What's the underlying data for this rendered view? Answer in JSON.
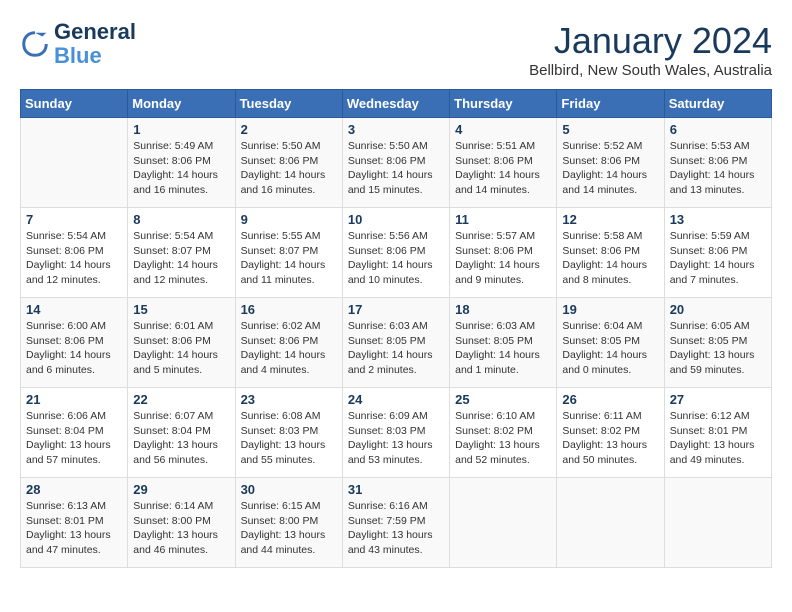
{
  "header": {
    "logo_line1": "General",
    "logo_line2": "Blue",
    "month_year": "January 2024",
    "location": "Bellbird, New South Wales, Australia"
  },
  "days_of_week": [
    "Sunday",
    "Monday",
    "Tuesday",
    "Wednesday",
    "Thursday",
    "Friday",
    "Saturday"
  ],
  "weeks": [
    [
      {
        "day": "",
        "info": ""
      },
      {
        "day": "1",
        "info": "Sunrise: 5:49 AM\nSunset: 8:06 PM\nDaylight: 14 hours\nand 16 minutes."
      },
      {
        "day": "2",
        "info": "Sunrise: 5:50 AM\nSunset: 8:06 PM\nDaylight: 14 hours\nand 16 minutes."
      },
      {
        "day": "3",
        "info": "Sunrise: 5:50 AM\nSunset: 8:06 PM\nDaylight: 14 hours\nand 15 minutes."
      },
      {
        "day": "4",
        "info": "Sunrise: 5:51 AM\nSunset: 8:06 PM\nDaylight: 14 hours\nand 14 minutes."
      },
      {
        "day": "5",
        "info": "Sunrise: 5:52 AM\nSunset: 8:06 PM\nDaylight: 14 hours\nand 14 minutes."
      },
      {
        "day": "6",
        "info": "Sunrise: 5:53 AM\nSunset: 8:06 PM\nDaylight: 14 hours\nand 13 minutes."
      }
    ],
    [
      {
        "day": "7",
        "info": "Sunrise: 5:54 AM\nSunset: 8:06 PM\nDaylight: 14 hours\nand 12 minutes."
      },
      {
        "day": "8",
        "info": "Sunrise: 5:54 AM\nSunset: 8:07 PM\nDaylight: 14 hours\nand 12 minutes."
      },
      {
        "day": "9",
        "info": "Sunrise: 5:55 AM\nSunset: 8:07 PM\nDaylight: 14 hours\nand 11 minutes."
      },
      {
        "day": "10",
        "info": "Sunrise: 5:56 AM\nSunset: 8:06 PM\nDaylight: 14 hours\nand 10 minutes."
      },
      {
        "day": "11",
        "info": "Sunrise: 5:57 AM\nSunset: 8:06 PM\nDaylight: 14 hours\nand 9 minutes."
      },
      {
        "day": "12",
        "info": "Sunrise: 5:58 AM\nSunset: 8:06 PM\nDaylight: 14 hours\nand 8 minutes."
      },
      {
        "day": "13",
        "info": "Sunrise: 5:59 AM\nSunset: 8:06 PM\nDaylight: 14 hours\nand 7 minutes."
      }
    ],
    [
      {
        "day": "14",
        "info": "Sunrise: 6:00 AM\nSunset: 8:06 PM\nDaylight: 14 hours\nand 6 minutes."
      },
      {
        "day": "15",
        "info": "Sunrise: 6:01 AM\nSunset: 8:06 PM\nDaylight: 14 hours\nand 5 minutes."
      },
      {
        "day": "16",
        "info": "Sunrise: 6:02 AM\nSunset: 8:06 PM\nDaylight: 14 hours\nand 4 minutes."
      },
      {
        "day": "17",
        "info": "Sunrise: 6:03 AM\nSunset: 8:05 PM\nDaylight: 14 hours\nand 2 minutes."
      },
      {
        "day": "18",
        "info": "Sunrise: 6:03 AM\nSunset: 8:05 PM\nDaylight: 14 hours\nand 1 minute."
      },
      {
        "day": "19",
        "info": "Sunrise: 6:04 AM\nSunset: 8:05 PM\nDaylight: 14 hours\nand 0 minutes."
      },
      {
        "day": "20",
        "info": "Sunrise: 6:05 AM\nSunset: 8:05 PM\nDaylight: 13 hours\nand 59 minutes."
      }
    ],
    [
      {
        "day": "21",
        "info": "Sunrise: 6:06 AM\nSunset: 8:04 PM\nDaylight: 13 hours\nand 57 minutes."
      },
      {
        "day": "22",
        "info": "Sunrise: 6:07 AM\nSunset: 8:04 PM\nDaylight: 13 hours\nand 56 minutes."
      },
      {
        "day": "23",
        "info": "Sunrise: 6:08 AM\nSunset: 8:03 PM\nDaylight: 13 hours\nand 55 minutes."
      },
      {
        "day": "24",
        "info": "Sunrise: 6:09 AM\nSunset: 8:03 PM\nDaylight: 13 hours\nand 53 minutes."
      },
      {
        "day": "25",
        "info": "Sunrise: 6:10 AM\nSunset: 8:02 PM\nDaylight: 13 hours\nand 52 minutes."
      },
      {
        "day": "26",
        "info": "Sunrise: 6:11 AM\nSunset: 8:02 PM\nDaylight: 13 hours\nand 50 minutes."
      },
      {
        "day": "27",
        "info": "Sunrise: 6:12 AM\nSunset: 8:01 PM\nDaylight: 13 hours\nand 49 minutes."
      }
    ],
    [
      {
        "day": "28",
        "info": "Sunrise: 6:13 AM\nSunset: 8:01 PM\nDaylight: 13 hours\nand 47 minutes."
      },
      {
        "day": "29",
        "info": "Sunrise: 6:14 AM\nSunset: 8:00 PM\nDaylight: 13 hours\nand 46 minutes."
      },
      {
        "day": "30",
        "info": "Sunrise: 6:15 AM\nSunset: 8:00 PM\nDaylight: 13 hours\nand 44 minutes."
      },
      {
        "day": "31",
        "info": "Sunrise: 6:16 AM\nSunset: 7:59 PM\nDaylight: 13 hours\nand 43 minutes."
      },
      {
        "day": "",
        "info": ""
      },
      {
        "day": "",
        "info": ""
      },
      {
        "day": "",
        "info": ""
      }
    ]
  ]
}
